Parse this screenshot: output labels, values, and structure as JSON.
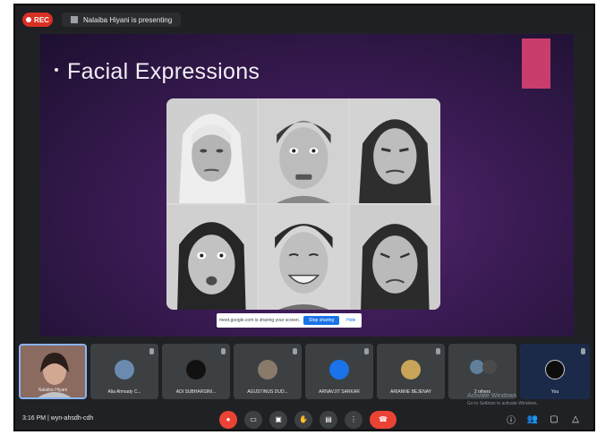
{
  "topbar": {
    "rec_label": "REC",
    "presenting_text": "Nalaiba Hiyani is presenting"
  },
  "slide": {
    "title": "Facial Expressions"
  },
  "share_bar": {
    "message": "meet.google.com is sharing your screen.",
    "stop_label": "Stop sharing",
    "hide_label": "Hide"
  },
  "participants": [
    {
      "name": "Nalaiba Hiyani"
    },
    {
      "name": "Alia Ahmady C..."
    },
    {
      "name": "ADI SUBHARSINI..."
    },
    {
      "name": "AGUSTINUS DUD..."
    },
    {
      "name": "ARNAVJIT SARKAR"
    },
    {
      "name": "ARIANNE BEJENAY"
    },
    {
      "name": "2 others"
    },
    {
      "name": "You"
    }
  ],
  "bottombar": {
    "meet_info": "3:16 PM  |  wyn-ahsdh-cdh"
  },
  "watermark": {
    "line1": "Activate Windows",
    "line2": "Go to Settings to activate Windows."
  },
  "icons": {
    "mic": "mic-off-icon",
    "camera": "camera-icon",
    "captions": "captions-icon",
    "hand": "raise-hand-icon",
    "present": "present-icon",
    "more": "more-icon",
    "end": "end-call-icon"
  },
  "colors": {
    "accent_red": "#ea4335",
    "slide_purple": "#3e1c58",
    "slide_accent": "#c83d6b",
    "bar_bg": "#202124",
    "tile_bg": "#3c4043"
  }
}
